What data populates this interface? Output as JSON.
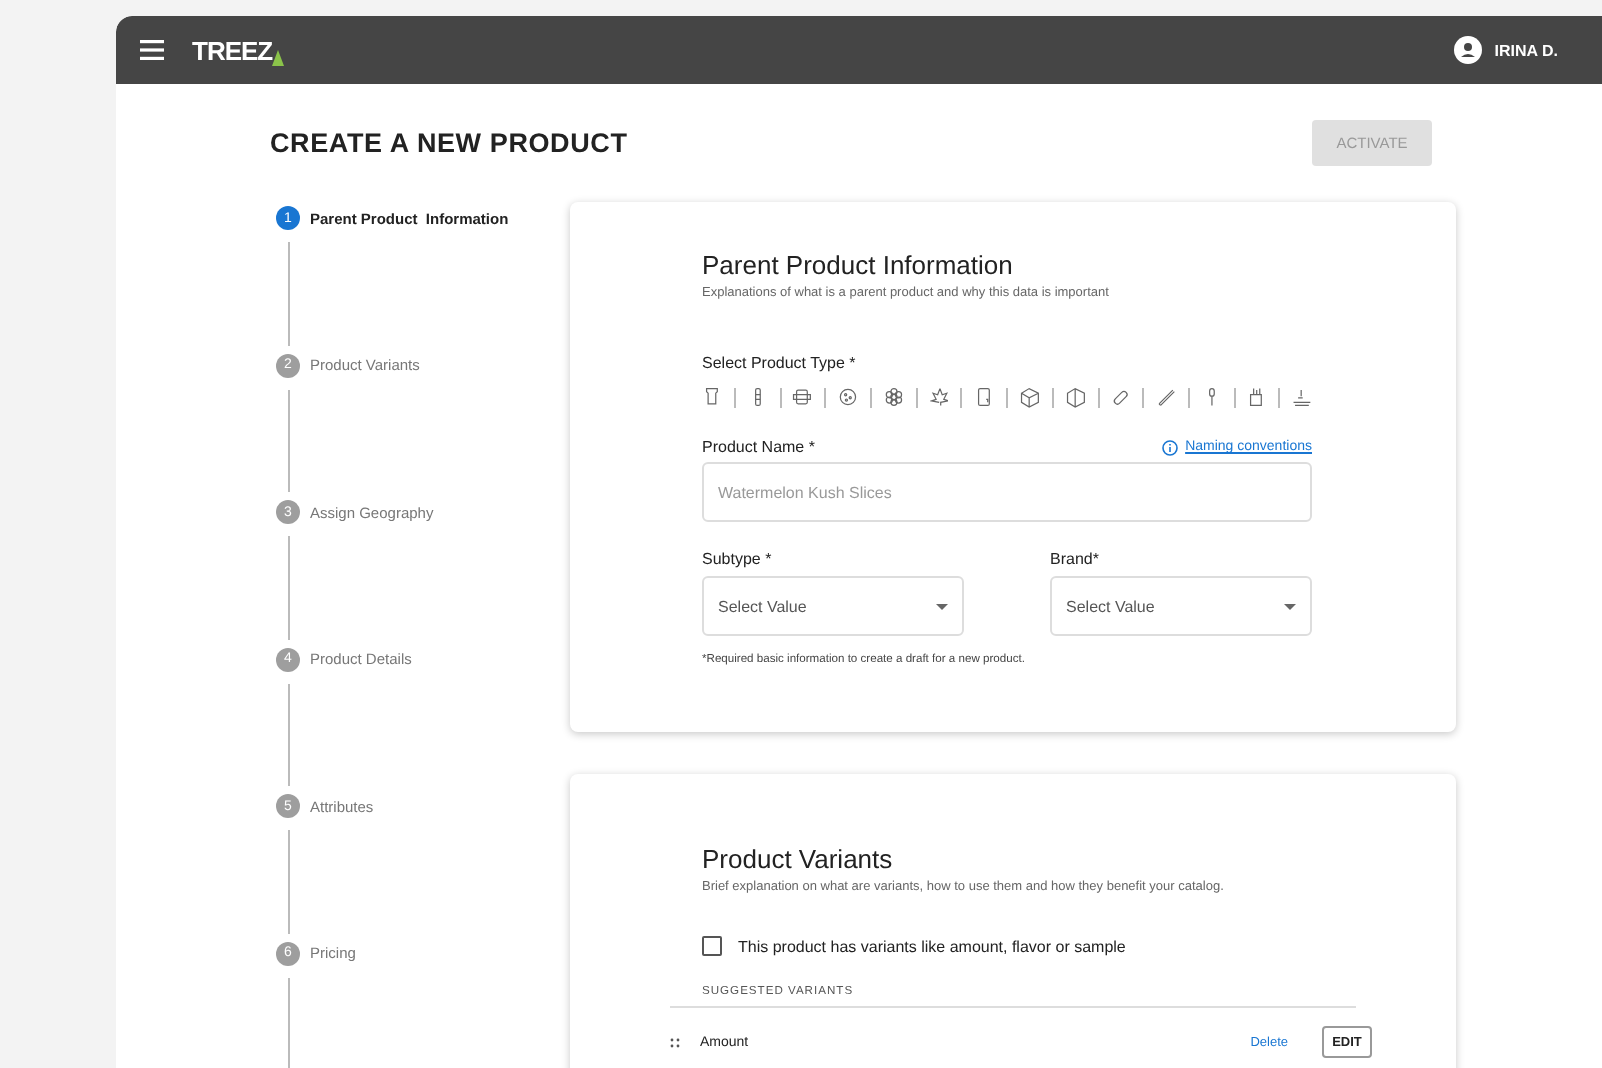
{
  "header": {
    "logo": "TREEZ",
    "user": "IRINA D."
  },
  "page": {
    "title": "CREATE A NEW PRODUCT",
    "activate_button": {
      "label": "ACTIVATE",
      "disabled": true
    }
  },
  "steps": [
    {
      "number": "1",
      "label": "Parent Product  Information",
      "selected": true
    },
    {
      "number": "2",
      "label": "Product Variants",
      "selected": false
    },
    {
      "number": "3",
      "label": "Assign Geography",
      "selected": false
    },
    {
      "number": "4",
      "label": "Product Details",
      "selected": false
    },
    {
      "number": "5",
      "label": "Attributes",
      "selected": false
    },
    {
      "number": "6",
      "label": "Pricing",
      "selected": false
    }
  ],
  "parent_card": {
    "title": "Parent Product Information",
    "description": "Explanations of what is a parent product and why this data is important",
    "product_type_label": "Select Product Type *",
    "product_name_label": "Product Name *",
    "naming_link": "Naming conventions",
    "product_name_placeholder": "Watermelon Kush Slices",
    "subtype_label": "Subtype *",
    "subtype_placeholder": "Select Value",
    "brand_label": "Brand*",
    "brand_placeholder": "Select Value",
    "footnote": "*Required basic information to create a draft for a new product."
  },
  "variants_card": {
    "title": "Product Variants",
    "description": "Brief explanation on what are variants, how to use them and how they benefit your catalog.",
    "checkbox": {
      "label": "This product has variants like amount, flavor  or sample",
      "checked": false
    },
    "suggested_heading": "SUGGESTED VARIANTS",
    "variants": [
      {
        "name": "Amount",
        "delete": "Delete",
        "edit": "EDIT"
      }
    ]
  }
}
